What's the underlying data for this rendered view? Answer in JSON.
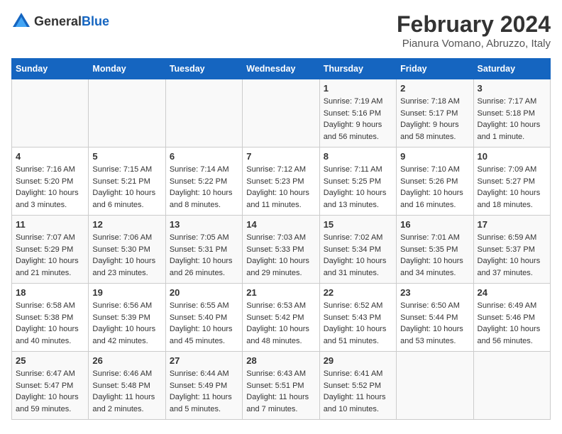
{
  "header": {
    "logo": {
      "general": "General",
      "blue": "Blue"
    },
    "title": "February 2024",
    "subtitle": "Pianura Vomano, Abruzzo, Italy"
  },
  "weekdays": [
    "Sunday",
    "Monday",
    "Tuesday",
    "Wednesday",
    "Thursday",
    "Friday",
    "Saturday"
  ],
  "weeks": [
    {
      "days": [
        {
          "number": "",
          "info": ""
        },
        {
          "number": "",
          "info": ""
        },
        {
          "number": "",
          "info": ""
        },
        {
          "number": "",
          "info": ""
        },
        {
          "number": "1",
          "info": "Sunrise: 7:19 AM\nSunset: 5:16 PM\nDaylight: 9 hours and 56 minutes."
        },
        {
          "number": "2",
          "info": "Sunrise: 7:18 AM\nSunset: 5:17 PM\nDaylight: 9 hours and 58 minutes."
        },
        {
          "number": "3",
          "info": "Sunrise: 7:17 AM\nSunset: 5:18 PM\nDaylight: 10 hours and 1 minute."
        }
      ]
    },
    {
      "days": [
        {
          "number": "4",
          "info": "Sunrise: 7:16 AM\nSunset: 5:20 PM\nDaylight: 10 hours and 3 minutes."
        },
        {
          "number": "5",
          "info": "Sunrise: 7:15 AM\nSunset: 5:21 PM\nDaylight: 10 hours and 6 minutes."
        },
        {
          "number": "6",
          "info": "Sunrise: 7:14 AM\nSunset: 5:22 PM\nDaylight: 10 hours and 8 minutes."
        },
        {
          "number": "7",
          "info": "Sunrise: 7:12 AM\nSunset: 5:23 PM\nDaylight: 10 hours and 11 minutes."
        },
        {
          "number": "8",
          "info": "Sunrise: 7:11 AM\nSunset: 5:25 PM\nDaylight: 10 hours and 13 minutes."
        },
        {
          "number": "9",
          "info": "Sunrise: 7:10 AM\nSunset: 5:26 PM\nDaylight: 10 hours and 16 minutes."
        },
        {
          "number": "10",
          "info": "Sunrise: 7:09 AM\nSunset: 5:27 PM\nDaylight: 10 hours and 18 minutes."
        }
      ]
    },
    {
      "days": [
        {
          "number": "11",
          "info": "Sunrise: 7:07 AM\nSunset: 5:29 PM\nDaylight: 10 hours and 21 minutes."
        },
        {
          "number": "12",
          "info": "Sunrise: 7:06 AM\nSunset: 5:30 PM\nDaylight: 10 hours and 23 minutes."
        },
        {
          "number": "13",
          "info": "Sunrise: 7:05 AM\nSunset: 5:31 PM\nDaylight: 10 hours and 26 minutes."
        },
        {
          "number": "14",
          "info": "Sunrise: 7:03 AM\nSunset: 5:33 PM\nDaylight: 10 hours and 29 minutes."
        },
        {
          "number": "15",
          "info": "Sunrise: 7:02 AM\nSunset: 5:34 PM\nDaylight: 10 hours and 31 minutes."
        },
        {
          "number": "16",
          "info": "Sunrise: 7:01 AM\nSunset: 5:35 PM\nDaylight: 10 hours and 34 minutes."
        },
        {
          "number": "17",
          "info": "Sunrise: 6:59 AM\nSunset: 5:37 PM\nDaylight: 10 hours and 37 minutes."
        }
      ]
    },
    {
      "days": [
        {
          "number": "18",
          "info": "Sunrise: 6:58 AM\nSunset: 5:38 PM\nDaylight: 10 hours and 40 minutes."
        },
        {
          "number": "19",
          "info": "Sunrise: 6:56 AM\nSunset: 5:39 PM\nDaylight: 10 hours and 42 minutes."
        },
        {
          "number": "20",
          "info": "Sunrise: 6:55 AM\nSunset: 5:40 PM\nDaylight: 10 hours and 45 minutes."
        },
        {
          "number": "21",
          "info": "Sunrise: 6:53 AM\nSunset: 5:42 PM\nDaylight: 10 hours and 48 minutes."
        },
        {
          "number": "22",
          "info": "Sunrise: 6:52 AM\nSunset: 5:43 PM\nDaylight: 10 hours and 51 minutes."
        },
        {
          "number": "23",
          "info": "Sunrise: 6:50 AM\nSunset: 5:44 PM\nDaylight: 10 hours and 53 minutes."
        },
        {
          "number": "24",
          "info": "Sunrise: 6:49 AM\nSunset: 5:46 PM\nDaylight: 10 hours and 56 minutes."
        }
      ]
    },
    {
      "days": [
        {
          "number": "25",
          "info": "Sunrise: 6:47 AM\nSunset: 5:47 PM\nDaylight: 10 hours and 59 minutes."
        },
        {
          "number": "26",
          "info": "Sunrise: 6:46 AM\nSunset: 5:48 PM\nDaylight: 11 hours and 2 minutes."
        },
        {
          "number": "27",
          "info": "Sunrise: 6:44 AM\nSunset: 5:49 PM\nDaylight: 11 hours and 5 minutes."
        },
        {
          "number": "28",
          "info": "Sunrise: 6:43 AM\nSunset: 5:51 PM\nDaylight: 11 hours and 7 minutes."
        },
        {
          "number": "29",
          "info": "Sunrise: 6:41 AM\nSunset: 5:52 PM\nDaylight: 11 hours and 10 minutes."
        },
        {
          "number": "",
          "info": ""
        },
        {
          "number": "",
          "info": ""
        }
      ]
    }
  ]
}
